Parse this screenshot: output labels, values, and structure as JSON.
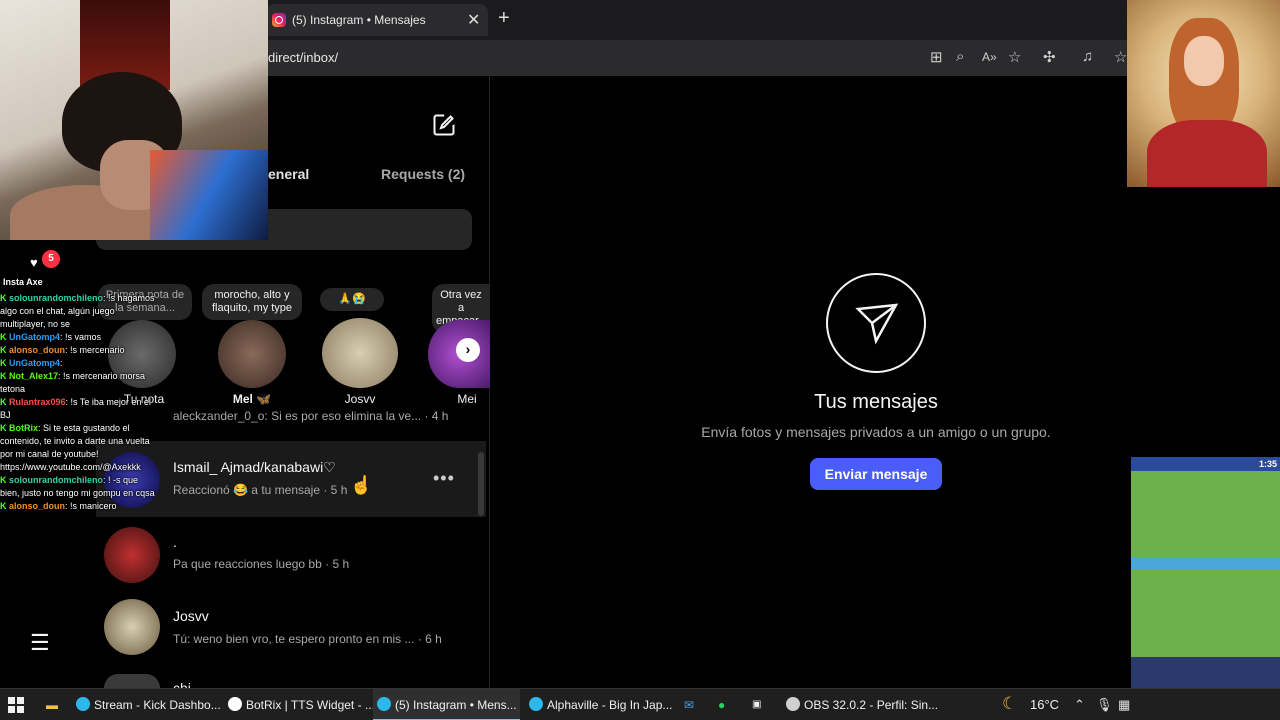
{
  "browser": {
    "tab_title": "(5) Instagram • Mensajes",
    "url": "direct/inbox/"
  },
  "inbox": {
    "tab_general": "eneral",
    "tab_requests": "Requests (2)",
    "notes": [
      {
        "bubble": "Primera nota de la semana...",
        "name": "Tu nota"
      },
      {
        "bubble": "morocho, alto y flaquito, my type",
        "name": "Mel 🦋"
      },
      {
        "bubble": "🙏😭",
        "name": "Josvv"
      },
      {
        "bubble": "Otra vez a empacar...",
        "name": "Mei"
      }
    ],
    "conversations": [
      {
        "name": "",
        "message": "aleckzander_0_o: Si es por eso elimina la ve... · 4 h"
      },
      {
        "name": "Ismail_ Ajmad/kanabawi♡",
        "message": "Reaccionó 😂 a tu mensaje · 5 h"
      },
      {
        "name": ".",
        "message": "Pa que reacciones luego bb · 5 h"
      },
      {
        "name": "Josvv",
        "message": "Tú: weno bien vro, te espero pronto en mis ... · 6 h"
      },
      {
        "name": "chi",
        "message": ""
      }
    ]
  },
  "empty_state": {
    "title": "Tus mensajes",
    "subtitle": "Envía fotos y mensajes privados a un amigo o un grupo.",
    "button": "Enviar mensaje"
  },
  "overlay": {
    "notif_count": "5",
    "insta_label": "Insta Axe",
    "chat": [
      {
        "user": "solounrandomchileno",
        "color": "#37d2a6",
        "text": ": !s hagamos algo con el chat, algún juego multiplayer, no se"
      },
      {
        "user": "UnGatomp4",
        "color": "#2a9df4",
        "text": ": !s vamos"
      },
      {
        "user": "alonso_doun",
        "color": "#f28c28",
        "text": ": !s mercenario"
      },
      {
        "user": "UnGatomp4",
        "color": "#2a9df4",
        "text": ":"
      },
      {
        "user": "Not_Alex17",
        "color": "#53fc18",
        "text": ": !s mercenario morsa tetona"
      },
      {
        "user": "Rulantrax096",
        "color": "#ff4d4d",
        "text": ": !s Te iba mejor en el BJ"
      },
      {
        "user": "BotRix",
        "color": "#53fc18",
        "text": ": Si te esta gustando el contenido, te invito a darte una vuelta por mi canal de youtube! https://www.youtube.com/@Axekkk"
      },
      {
        "user": "solounrandomchileno",
        "color": "#37d2a6",
        "text": ": ! -s que bien, justo no tengo mi gompu en cqsa"
      },
      {
        "user": "alonso_doun",
        "color": "#f28c28",
        "text": ": !s manicero"
      }
    ],
    "game_time": "1:35"
  },
  "taskbar": {
    "items": [
      {
        "label": "Stream - Kick Dashbo...",
        "color": "#2fb6ea"
      },
      {
        "label": "BotRix | TTS Widget - ...",
        "color": "#ffffff"
      },
      {
        "label": "(5) Instagram • Mens...",
        "color": "#2fb6ea"
      },
      {
        "label": "Alphaville - Big In Jap...",
        "color": "#2fb6ea"
      },
      {
        "label": "OBS 32.0.2 - Perfil: Sin...",
        "color": "#d0d0d0"
      }
    ],
    "temperature": "16°C"
  },
  "colors": {
    "accent_button": "#4a5df9",
    "notif_badge": "#ff3040",
    "background": "#000000"
  }
}
